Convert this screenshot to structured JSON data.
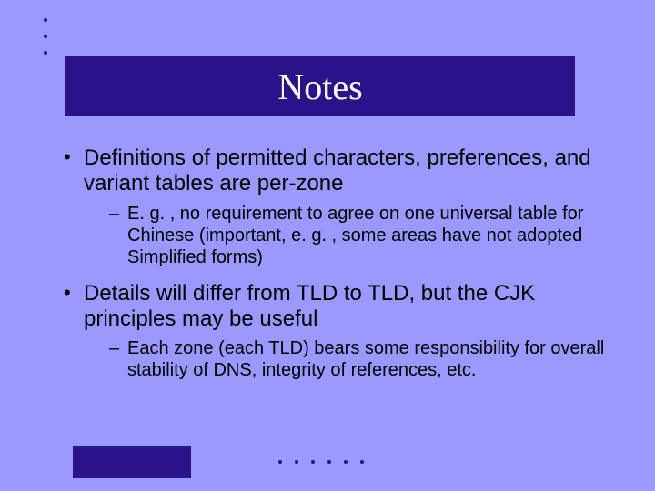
{
  "title": "Notes",
  "bullets": [
    {
      "text": "Definitions of permitted characters, preferences, and variant tables are per-zone",
      "sub": [
        "E. g. , no requirement to agree on one universal table for Chinese (important, e. g. , some areas have not adopted Simplified forms)"
      ]
    },
    {
      "text": "Details will differ from TLD to TLD, but the CJK principles may be useful",
      "sub": [
        "Each zone (each TLD) bears some responsibility for overall stability of DNS, integrity of references, etc."
      ]
    }
  ],
  "colors": {
    "background": "#9999ff",
    "accent": "#2b1288",
    "title_text": "#ffffff",
    "body_text": "#000000"
  }
}
